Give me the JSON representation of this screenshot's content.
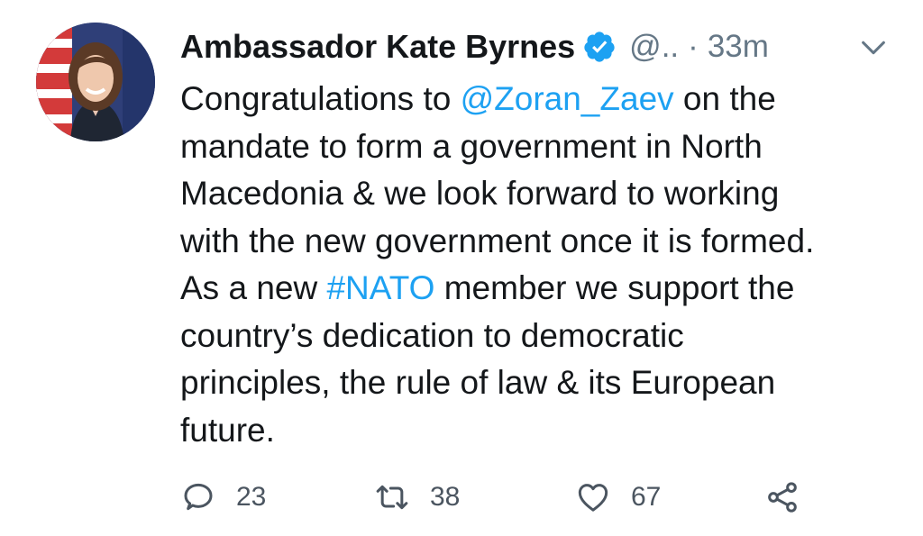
{
  "author": {
    "name": "Ambassador Kate Byrnes",
    "handle": "@..",
    "separator": "·",
    "time": "33m",
    "verified": true
  },
  "tweet": {
    "lines": [
      [
        {
          "text": "Congratulations to ",
          "type": "text"
        },
        {
          "text": "@Zoran_Zaev",
          "type": "mention"
        },
        {
          "text": " on the",
          "type": "text"
        }
      ],
      [
        {
          "text": "mandate to form a government in North",
          "type": "text"
        }
      ],
      [
        {
          "text": "Macedonia & we look forward to working",
          "type": "text"
        }
      ],
      [
        {
          "text": "with the new government once it is formed.",
          "type": "text"
        }
      ],
      [
        {
          "text": "As a new ",
          "type": "text"
        },
        {
          "text": "#NATO",
          "type": "hashtag"
        },
        {
          "text": " member we support the",
          "type": "text"
        }
      ],
      [
        {
          "text": "country’s dedication to democratic",
          "type": "text"
        }
      ],
      [
        {
          "text": "principles, the rule of law & its European",
          "type": "text"
        }
      ],
      [
        {
          "text": "future.",
          "type": "text"
        }
      ]
    ]
  },
  "actions": {
    "reply_count": "23",
    "retweet_count": "38",
    "like_count": "67"
  },
  "icons": {
    "verified": "verified-badge-icon",
    "caret": "chevron-down-icon",
    "reply": "reply-bubble-icon",
    "retweet": "retweet-icon",
    "like": "heart-icon",
    "share": "share-icon"
  },
  "colors": {
    "link": "#1da1f2",
    "secondary_text": "#657786",
    "primary_text": "#14171a"
  }
}
